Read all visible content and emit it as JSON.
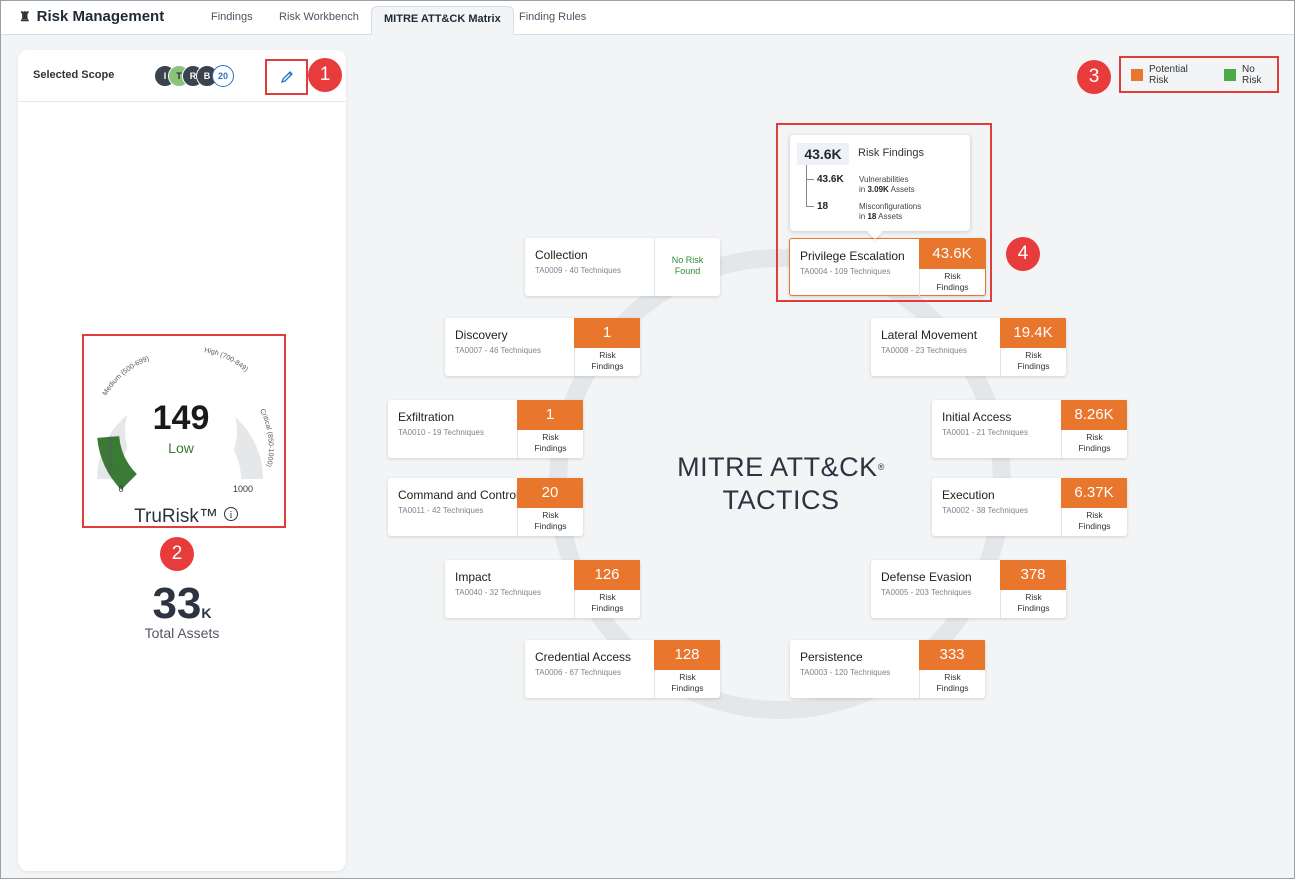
{
  "app": {
    "title": "Risk Management"
  },
  "tabs": [
    {
      "label": "Findings"
    },
    {
      "label": "Risk Workbench"
    },
    {
      "label": "MITRE ATT&CK Matrix"
    },
    {
      "label": "Finding Rules"
    }
  ],
  "scope": {
    "label": "Selected Scope",
    "chips": [
      "I",
      "T",
      "R",
      "B",
      "20"
    ]
  },
  "gauge": {
    "score": "149",
    "level": "Low",
    "score_value": 149,
    "min": "0",
    "max": "1000",
    "bands": {
      "low": "Low (0-499)",
      "medium": "Medium (500-699)",
      "high": "High (700-849)",
      "critical": "Critical (850-1000)"
    },
    "title": "TruRisk™"
  },
  "assets": {
    "count": "33",
    "unit": "K",
    "label": "Total Assets"
  },
  "legend": {
    "potential": "Potential Risk",
    "norisk": "No Risk"
  },
  "colors": {
    "potential": "#e8762d",
    "norisk": "#4caa48",
    "highlight": "#e03c3c"
  },
  "callouts": [
    "1",
    "2",
    "3",
    "4"
  ],
  "center": {
    "line1": "MITRE ATT&CK",
    "reg": "®",
    "line2": "TACTICS"
  },
  "tooltip": {
    "total": "43.6K",
    "title": "Risk Findings",
    "vuln_num": "43.6K",
    "vuln_label": "Vulnerabilities",
    "vuln_in": "in",
    "vuln_assets": "3.09K",
    "vuln_assets_label": "Assets",
    "misc_num": "18",
    "misc_label": "Misconfigurations",
    "misc_in": "in",
    "misc_assets": "18",
    "misc_assets_label": "Assets"
  },
  "risk_findings_label": [
    "Risk",
    "Findings"
  ],
  "no_risk_label": [
    "No Risk",
    "Found"
  ],
  "tactics": [
    {
      "name": "Collection",
      "tech": "TA0009 - 40 Techniques",
      "value": ""
    },
    {
      "name": "Privilege Escalation",
      "tech": "TA0004 - 109 Techniques",
      "value": "43.6K"
    },
    {
      "name": "Discovery",
      "tech": "TA0007 - 46 Techniques",
      "value": "1"
    },
    {
      "name": "Lateral Movement",
      "tech": "TA0008 - 23 Techniques",
      "value": "19.4K"
    },
    {
      "name": "Exfiltration",
      "tech": "TA0010 - 19 Techniques",
      "value": "1"
    },
    {
      "name": "Initial Access",
      "tech": "TA0001 - 21 Techniques",
      "value": "8.26K"
    },
    {
      "name": "Command and Control",
      "tech": "TA0011 - 42 Techniques",
      "value": "20"
    },
    {
      "name": "Execution",
      "tech": "TA0002 - 38 Techniques",
      "value": "6.37K"
    },
    {
      "name": "Impact",
      "tech": "TA0040 - 32 Techniques",
      "value": "126"
    },
    {
      "name": "Defense Evasion",
      "tech": "TA0005 - 203 Techniques",
      "value": "378"
    },
    {
      "name": "Credential Access",
      "tech": "TA0006 - 67 Techniques",
      "value": "128"
    },
    {
      "name": "Persistence",
      "tech": "TA0003 - 120 Techniques",
      "value": "333"
    }
  ]
}
